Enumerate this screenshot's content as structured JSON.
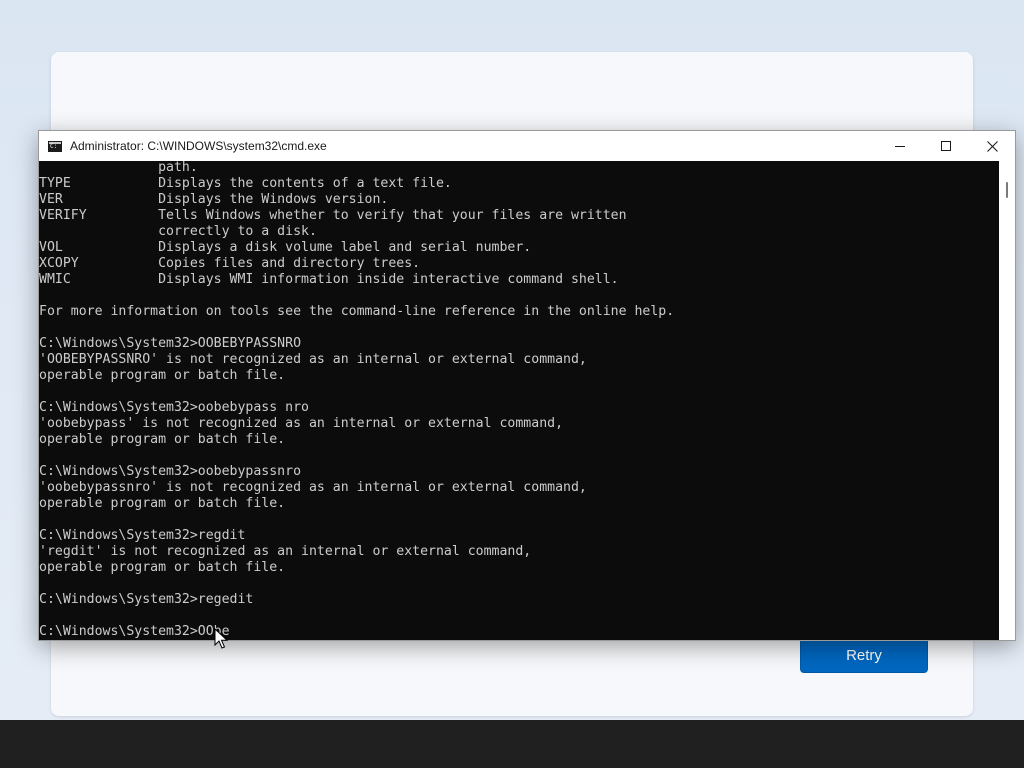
{
  "window": {
    "title": "Administrator: C:\\WINDOWS\\system32\\cmd.exe",
    "icon": "cmd-icon"
  },
  "controls": {
    "minimize": "minimize-icon",
    "maximize": "maximize-icon",
    "close": "close-icon"
  },
  "console": {
    "lines": [
      "               path.",
      "TYPE           Displays the contents of a text file.",
      "VER            Displays the Windows version.",
      "VERIFY         Tells Windows whether to verify that your files are written",
      "               correctly to a disk.",
      "VOL            Displays a disk volume label and serial number.",
      "XCOPY          Copies files and directory trees.",
      "WMIC           Displays WMI information inside interactive command shell.",
      "",
      "For more information on tools see the command-line reference in the online help.",
      "",
      "C:\\Windows\\System32>OOBEBYPASSNRO",
      "'OOBEBYPASSNRO' is not recognized as an internal or external command,",
      "operable program or batch file.",
      "",
      "C:\\Windows\\System32>oobebypass nro",
      "'oobebypass' is not recognized as an internal or external command,",
      "operable program or batch file.",
      "",
      "C:\\Windows\\System32>oobebypassnro",
      "'oobebypassnro' is not recognized as an internal or external command,",
      "operable program or batch file.",
      "",
      "C:\\Windows\\System32>regdit",
      "'regdit' is not recognized as an internal or external command,",
      "operable program or batch file.",
      "",
      "C:\\Windows\\System32>regedit",
      "",
      "C:\\Windows\\System32>OObe"
    ]
  },
  "oobe": {
    "retry_label": "Retry"
  },
  "colors": {
    "console_bg": "#0c0c0c",
    "console_fg": "#cccccc",
    "accent": "#0067c0",
    "taskbar": "#202020"
  }
}
